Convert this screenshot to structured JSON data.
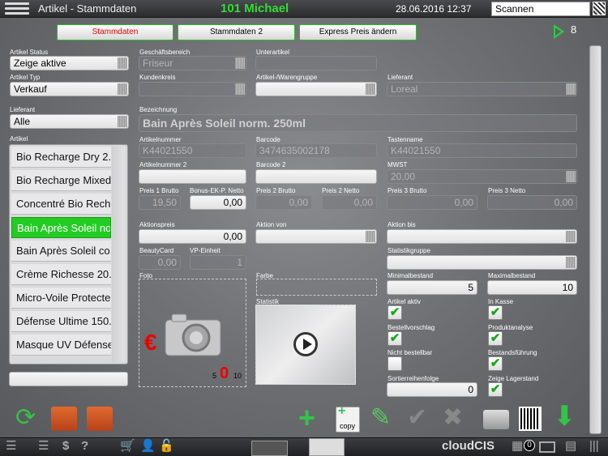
{
  "header": {
    "title": "Artikel - Stammdaten",
    "customer": "101 Michael",
    "datetime": "28.06.2016 12:37",
    "scan_value": "Scannen"
  },
  "tabs": [
    "Stammdaten",
    "Stammdaten 2",
    "Express Preis ändern"
  ],
  "nav_count": "8",
  "left": {
    "artikel_status_label": "Artikel Status",
    "artikel_status_value": "Zeige aktive",
    "artikel_typ_label": "Artikel Typ",
    "artikel_typ_value": "Verkauf",
    "lieferant_label": "Lieferant",
    "lieferant_value": "Alle",
    "artikel_label": "Artikel",
    "items": [
      "Bio Recharge Dry 2...",
      "Bio Recharge Mixed...",
      "Concentré Bio Rech...",
      "Bain Après Soleil no...",
      "Bain Après Soleil co...",
      "Crème Richesse 20...",
      "Micro-Voile Protecte...",
      "Défense Ultime 150...",
      "Masque UV Défense..."
    ],
    "selected_index": 3
  },
  "form": {
    "geschaeftsbereich_label": "Geschäftsbereich",
    "geschaeftsbereich_value": "Friseur",
    "unterartikel_label": "Unterartikel",
    "kundenkreis_label": "Kundenkreis",
    "warengruppe_label": "Artikel-/Warengruppe",
    "lieferant_label": "Lieferant",
    "lieferant_value": "Loreal",
    "bezeichnung_label": "Bezeichnung",
    "bezeichnung_value": "Bain Après Soleil norm. 250ml",
    "artikelnummer_label": "Artikelnummer",
    "artikelnummer_value": "K44021550",
    "barcode_label": "Barcode",
    "barcode_value": "3474635002178",
    "tastenname_label": "Tastenname",
    "tastenname_value": "K44021550",
    "artikelnummer2_label": "Artikelnummer 2",
    "barcode2_label": "Barcode 2",
    "mwst_label": "MWST",
    "mwst_value": "20,00",
    "preis1_label": "Preis 1 Brutto",
    "preis1_value": "19,50",
    "bonus_label": "Bonus-EK-P. Netto",
    "bonus_value": "0,00",
    "preis2b_label": "Preis 2 Brutto",
    "preis2b_value": "0,00",
    "preis2n_label": "Preis 2 Netto",
    "preis2n_value": "0,00",
    "preis3b_label": "Preis 3 Brutto",
    "preis3b_value": "0,00",
    "preis3n_label": "Preis 3 Netto",
    "preis3n_value": "0,00",
    "aktionspreis_label": "Aktionspreis",
    "aktionspreis_value": "0,00",
    "aktion_von_label": "Aktion von",
    "aktion_bis_label": "Aktion bis",
    "beautycard_label": "BeautyCard",
    "beautycard_value": "0,00",
    "vp_label": "VP-Einheit",
    "vp_value": "1",
    "statistikgruppe_label": "Statistikgruppe",
    "foto_label": "Foto",
    "farbe_label": "Farbe",
    "statistik_label": "Statistik",
    "minimalbestand_label": "Minimalbestand",
    "minimalbestand_value": "5",
    "maximalbestand_label": "Maximalbestand",
    "maximalbestand_value": "10",
    "sortier_label": "Sortierreihenfolge",
    "sortier_value": "0"
  },
  "checks": {
    "artikel_aktiv": {
      "label": "Artikel aktiv",
      "checked": true
    },
    "in_kasse": {
      "label": "In Kasse",
      "checked": true
    },
    "bestellvorschlag": {
      "label": "Bestellvorschlag",
      "checked": true
    },
    "produktanalyse": {
      "label": "Produktanalyse",
      "checked": true
    },
    "nicht_bestellbar": {
      "label": "Nicht bestellbar",
      "checked": false
    },
    "bestandsfuehrung": {
      "label": "Bestandsführung",
      "checked": true
    },
    "zeige_lagerstand": {
      "label": "Zeige Lagerstand",
      "checked": true
    }
  },
  "photo": {
    "currency_symbol": "€",
    "stock_min": "5",
    "stock_current": "0",
    "stock_max": "10"
  },
  "toolbar": {
    "copy_label": "copy"
  },
  "footer": {
    "brand": "cloudCIS",
    "badge_count": "0"
  },
  "colors": {
    "accent_green": "#2ecc40",
    "active_tab_text": "#ee0000",
    "selected_row": "#22cc22"
  }
}
